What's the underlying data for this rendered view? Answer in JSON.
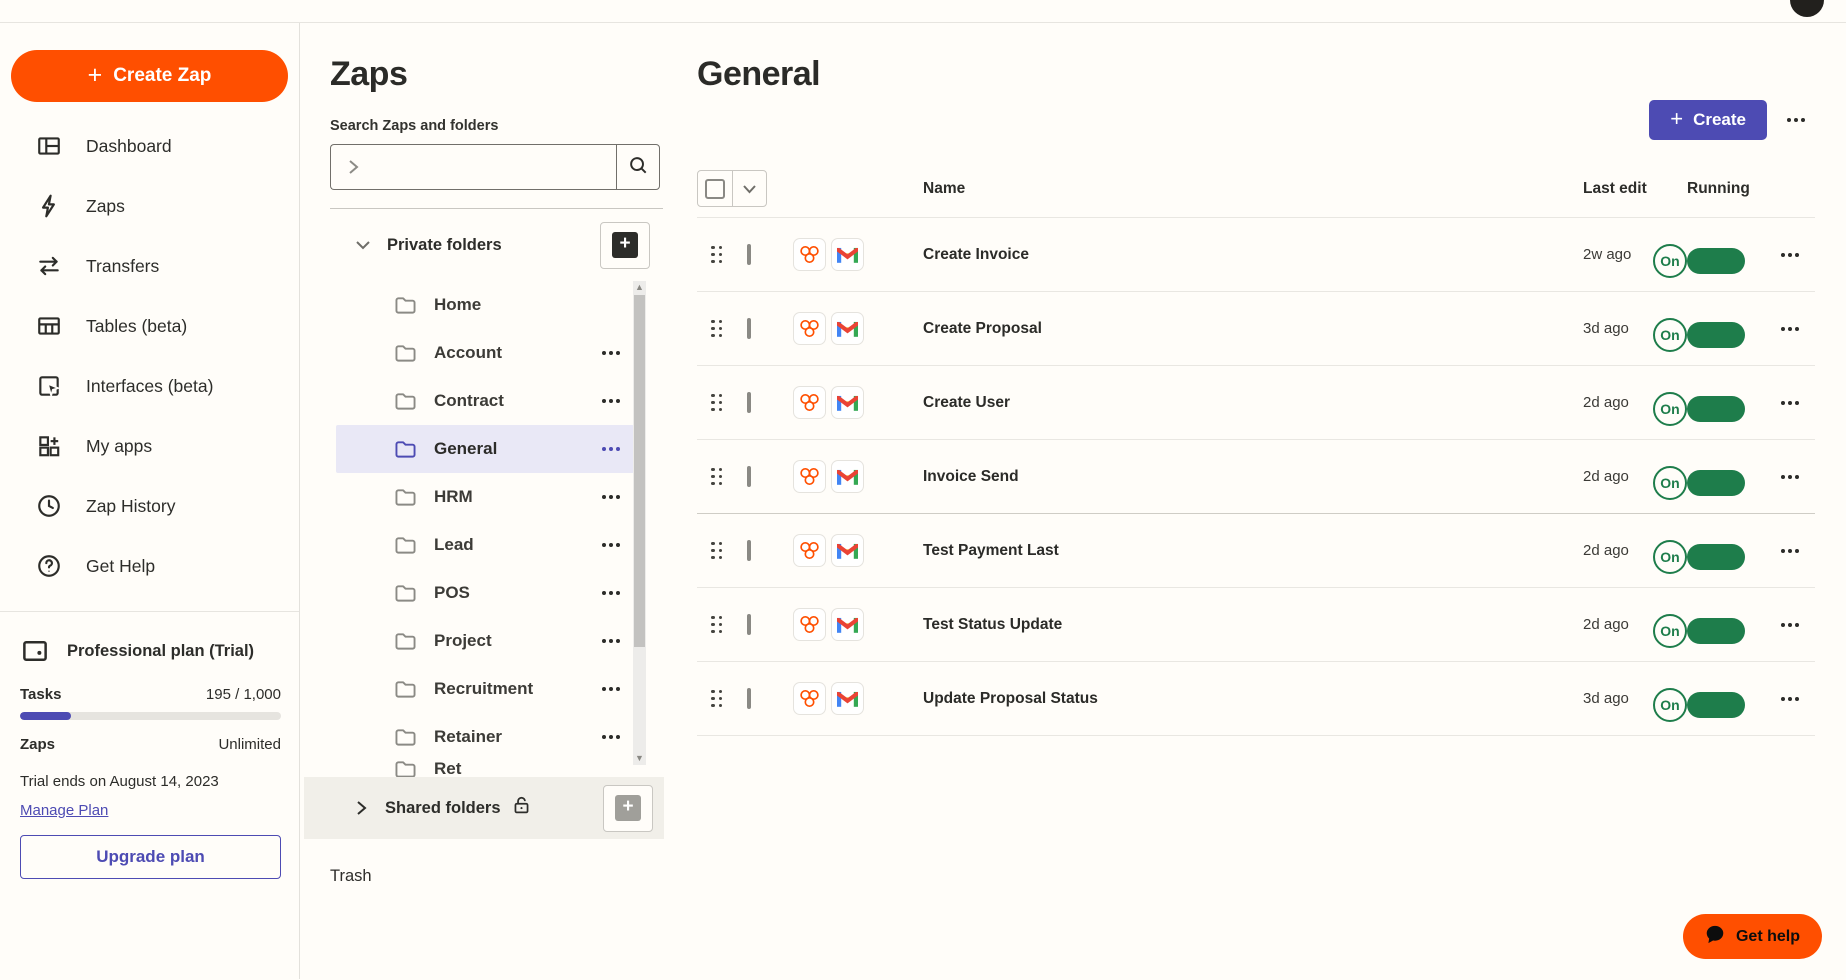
{
  "colors": {
    "accent_orange": "#ff4f00",
    "accent_indigo": "#4d4bb3",
    "toggle_green": "#1e7d4b",
    "selected_folder_bg": "#e9e8f6",
    "background": "#fffdf9"
  },
  "sidebar": {
    "create_zap_label": "Create Zap",
    "nav": [
      {
        "icon": "dashboard-icon",
        "label": "Dashboard"
      },
      {
        "icon": "zap-icon",
        "label": "Zaps"
      },
      {
        "icon": "transfers-icon",
        "label": "Transfers"
      },
      {
        "icon": "tables-icon",
        "label": "Tables (beta)"
      },
      {
        "icon": "interfaces-icon",
        "label": "Interfaces (beta)"
      },
      {
        "icon": "apps-icon",
        "label": "My apps"
      },
      {
        "icon": "history-icon",
        "label": "Zap History"
      },
      {
        "icon": "help-icon",
        "label": "Get Help"
      }
    ],
    "plan": {
      "name": "Professional plan (Trial)",
      "tasks_label": "Tasks",
      "tasks_value": "195 / 1,000",
      "tasks_pct": 19.5,
      "zaps_label": "Zaps",
      "zaps_value": "Unlimited",
      "trial_note": "Trial ends on August 14, 2023",
      "manage_link": "Manage Plan",
      "upgrade_label": "Upgrade plan"
    }
  },
  "folders_panel": {
    "title": "Zaps",
    "search_label": "Search Zaps and folders",
    "search_value": "",
    "private_header": "Private folders",
    "private_folders": [
      {
        "label": "Home",
        "menu": false,
        "selected": false,
        "clipped": false
      },
      {
        "label": "Account",
        "menu": true,
        "selected": false,
        "clipped": false
      },
      {
        "label": "Contract",
        "menu": true,
        "selected": false,
        "clipped": false
      },
      {
        "label": "General",
        "menu": true,
        "selected": true,
        "clipped": false
      },
      {
        "label": "HRM",
        "menu": true,
        "selected": false,
        "clipped": false
      },
      {
        "label": "Lead",
        "menu": true,
        "selected": false,
        "clipped": false
      },
      {
        "label": "POS",
        "menu": true,
        "selected": false,
        "clipped": false
      },
      {
        "label": "Project",
        "menu": true,
        "selected": false,
        "clipped": false
      },
      {
        "label": "Recruitment",
        "menu": true,
        "selected": false,
        "clipped": false
      },
      {
        "label": "Retainer",
        "menu": true,
        "selected": false,
        "clipped": false
      },
      {
        "label": "Ret",
        "menu": false,
        "selected": false,
        "clipped": true
      }
    ],
    "shared_header": "Shared folders",
    "trash_label": "Trash"
  },
  "main": {
    "title": "General",
    "create_label": "Create",
    "columns": {
      "name": "Name",
      "last_edit": "Last edit",
      "running": "Running"
    },
    "toggle_label": "On",
    "rows": [
      {
        "apps": [
          "webhooks-icon",
          "gmail-icon"
        ],
        "name": "Create Invoice",
        "last_edit": "2w ago",
        "running": "On",
        "heavy_divider": false
      },
      {
        "apps": [
          "webhooks-icon",
          "gmail-icon"
        ],
        "name": "Create Proposal",
        "last_edit": "3d ago",
        "running": "On",
        "heavy_divider": false
      },
      {
        "apps": [
          "webhooks-icon",
          "gmail-icon"
        ],
        "name": "Create User",
        "last_edit": "2d ago",
        "running": "On",
        "heavy_divider": false
      },
      {
        "apps": [
          "webhooks-icon",
          "gmail-icon"
        ],
        "name": "Invoice Send",
        "last_edit": "2d ago",
        "running": "On",
        "heavy_divider": true
      },
      {
        "apps": [
          "webhooks-icon",
          "gmail-icon"
        ],
        "name": "Test Payment Last",
        "last_edit": "2d ago",
        "running": "On",
        "heavy_divider": false
      },
      {
        "apps": [
          "webhooks-icon",
          "gmail-icon"
        ],
        "name": "Test Status Update",
        "last_edit": "2d ago",
        "running": "On",
        "heavy_divider": false
      },
      {
        "apps": [
          "webhooks-icon",
          "gmail-icon"
        ],
        "name": "Update Proposal Status",
        "last_edit": "3d ago",
        "running": "On",
        "heavy_divider": false
      }
    ]
  },
  "fab": {
    "label": "Get help"
  }
}
